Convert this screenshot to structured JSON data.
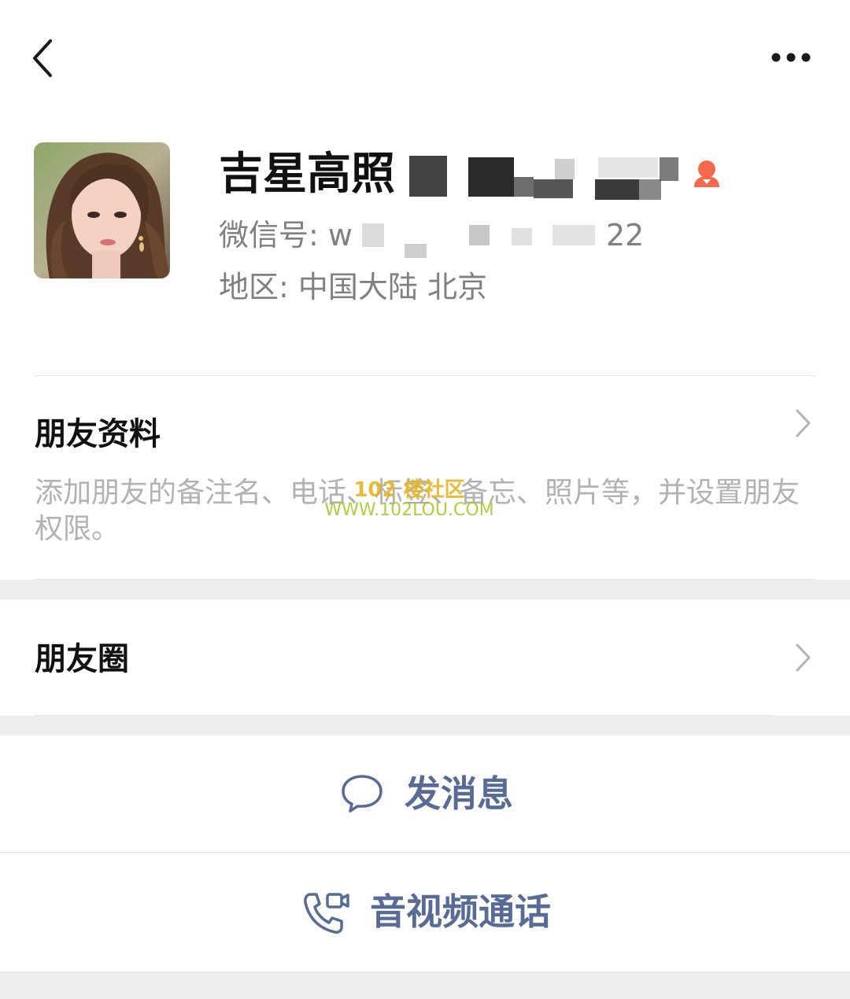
{
  "header": {
    "back_icon": "chevron-left-icon",
    "more_icon": "more-dots-icon"
  },
  "profile": {
    "nickname": "吉星高照",
    "wechat_id_label": "微信号: w",
    "wechat_id_tail": "22",
    "region_label": "地区: 中国大陆  北京",
    "gender_icon": "female-icon",
    "gender_color": "#f4694b"
  },
  "friend_profile": {
    "title": "朋友资料",
    "description": "添加朋友的备注名、电话、标签、备忘、照片等，并设置朋友权限。"
  },
  "watermark": {
    "line1": "102 楼社区",
    "line2": "WWW.102LOU.COM"
  },
  "moments": {
    "title": "朋友圈"
  },
  "actions": {
    "message_label": "发消息",
    "call_label": "音视频通话",
    "accent_color": "#576b95"
  }
}
